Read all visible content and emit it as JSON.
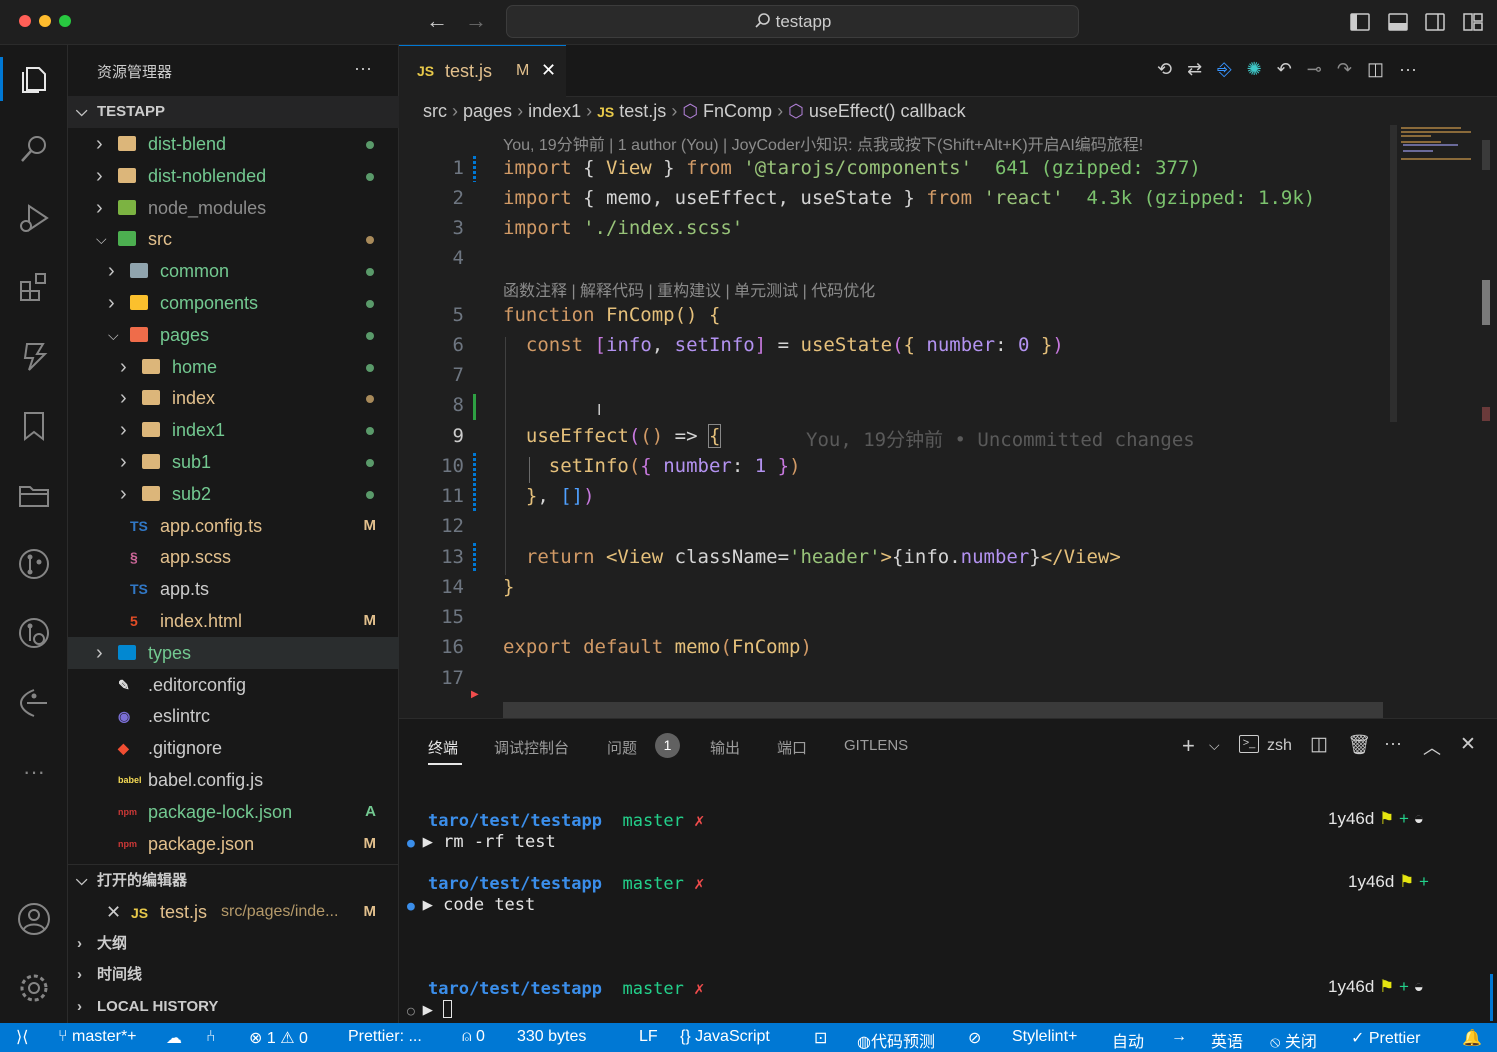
{
  "window": {
    "title": "testapp"
  },
  "explorer": {
    "header": "资源管理器",
    "more": "···",
    "root": "TESTAPP",
    "items": [
      {
        "label": "dist-blend",
        "type": "folder",
        "depth": 0,
        "open": false,
        "status": "dot",
        "color": "#73c991"
      },
      {
        "label": "dist-noblended",
        "type": "folder",
        "depth": 0,
        "open": false,
        "status": "dot",
        "color": "#73c991"
      },
      {
        "label": "node_modules",
        "type": "folder-node",
        "depth": 0,
        "open": false,
        "status": "",
        "color": "#8c8c8c"
      },
      {
        "label": "src",
        "type": "folder-src",
        "depth": 0,
        "open": true,
        "status": "dot",
        "color": "#e2c08d"
      },
      {
        "label": "common",
        "type": "folder-common",
        "depth": 1,
        "open": false,
        "status": "dot",
        "color": "#73c991"
      },
      {
        "label": "components",
        "type": "folder-components",
        "depth": 1,
        "open": false,
        "status": "dot",
        "color": "#73c991"
      },
      {
        "label": "pages",
        "type": "folder-pages",
        "depth": 1,
        "open": true,
        "status": "dot",
        "color": "#73c991"
      },
      {
        "label": "home",
        "type": "folder",
        "depth": 2,
        "open": false,
        "status": "dot",
        "color": "#73c991"
      },
      {
        "label": "index",
        "type": "folder",
        "depth": 2,
        "open": false,
        "status": "dot",
        "color": "#e2c08d"
      },
      {
        "label": "index1",
        "type": "folder",
        "depth": 2,
        "open": false,
        "status": "dot",
        "color": "#73c991"
      },
      {
        "label": "sub1",
        "type": "folder",
        "depth": 2,
        "open": false,
        "status": "dot",
        "color": "#73c991"
      },
      {
        "label": "sub2",
        "type": "folder",
        "depth": 2,
        "open": false,
        "status": "dot",
        "color": "#73c991"
      },
      {
        "label": "app.config.ts",
        "type": "ts",
        "depth": 1,
        "status": "M",
        "color": "#e2c08d"
      },
      {
        "label": "app.scss",
        "type": "scss",
        "depth": 1,
        "status": "",
        "color": "#e2c08d"
      },
      {
        "label": "app.ts",
        "type": "ts",
        "depth": 1,
        "status": "",
        "color": "#cccccc"
      },
      {
        "label": "index.html",
        "type": "html",
        "depth": 1,
        "status": "M",
        "color": "#e2c08d"
      },
      {
        "label": "types",
        "type": "folder-types",
        "depth": 0,
        "open": false,
        "status": "",
        "color": "#73c991"
      },
      {
        "label": ".editorconfig",
        "type": "editorconfig",
        "depth": 0,
        "status": "",
        "color": "#cccccc"
      },
      {
        "label": ".eslintrc",
        "type": "eslint",
        "depth": 0,
        "status": "",
        "color": "#cccccc"
      },
      {
        "label": ".gitignore",
        "type": "git",
        "depth": 0,
        "status": "",
        "color": "#cccccc"
      },
      {
        "label": "babel.config.js",
        "type": "babel",
        "depth": 0,
        "status": "",
        "color": "#cccccc"
      },
      {
        "label": "package-lock.json",
        "type": "npm",
        "depth": 0,
        "status": "A",
        "color": "#73c991"
      },
      {
        "label": "package.json",
        "type": "npm",
        "depth": 0,
        "status": "M",
        "color": "#e2c08d"
      }
    ],
    "open_editors": {
      "label": "打开的编辑器",
      "file": "test.js",
      "path": "src/pages/inde...",
      "status": "M"
    },
    "outline": "大纲",
    "timeline": "时间线",
    "local_history": "LOCAL HISTORY"
  },
  "editor": {
    "tab": {
      "lang": "JS",
      "name": "test.js",
      "status": "M"
    },
    "breadcrumb": [
      "src",
      "pages",
      "index1",
      "test.js",
      "FnComp",
      "useEffect() callback"
    ],
    "breadcrumb_js": "JS",
    "blame_header": "You, 19分钟前 | 1 author (You) | JoyCoder小知识: 点我或按下(Shift+Alt+K)开启AI编码旅程!",
    "codelens": "函数注释 | 解释代码 | 重构建议 | 单元测试 | 代码优化",
    "inline_blame": "You, 19分钟前 • Uncommitted changes",
    "import_cost_1": "641 (gzipped: 377)",
    "import_cost_2": "4.3k (gzipped: 1.9k)",
    "line_numbers": [
      "1",
      "2",
      "3",
      "4",
      "5",
      "6",
      "7",
      "8",
      "9",
      "10",
      "11",
      "12",
      "13",
      "14",
      "15",
      "16",
      "17"
    ]
  },
  "panel": {
    "tabs": [
      "终端",
      "调试控制台",
      "问题",
      "输出",
      "端口",
      "GITLENS"
    ],
    "problems_count": "1",
    "shell": "zsh",
    "prompts": [
      {
        "path": "taro/test/testapp",
        "branch": "master",
        "mark": "✗",
        "cmd": "rm -rf test",
        "time": "1y46d"
      },
      {
        "path": "taro/test/testapp",
        "branch": "master",
        "mark": "✗",
        "cmd": "code test",
        "time": "1y46d"
      },
      {
        "path": "taro/test/testapp",
        "branch": "master",
        "mark": "✗",
        "cmd": "",
        "time": "1y46d"
      }
    ]
  },
  "status": {
    "branch": "master*+",
    "errors": "1",
    "warnings": "0",
    "prettier_left": "Prettier: ...",
    "ports": "0",
    "size": "330 bytes",
    "eol": "LF",
    "language": "JavaScript",
    "predict": "代码预测",
    "stylelint": "Stylelint+",
    "auto": "自动",
    "lang_en": "英语",
    "off": "关闭",
    "prettier": "Prettier"
  },
  "colors": {
    "accent": "#0078d4",
    "modified": "#e2c08d",
    "added": "#73c991"
  }
}
